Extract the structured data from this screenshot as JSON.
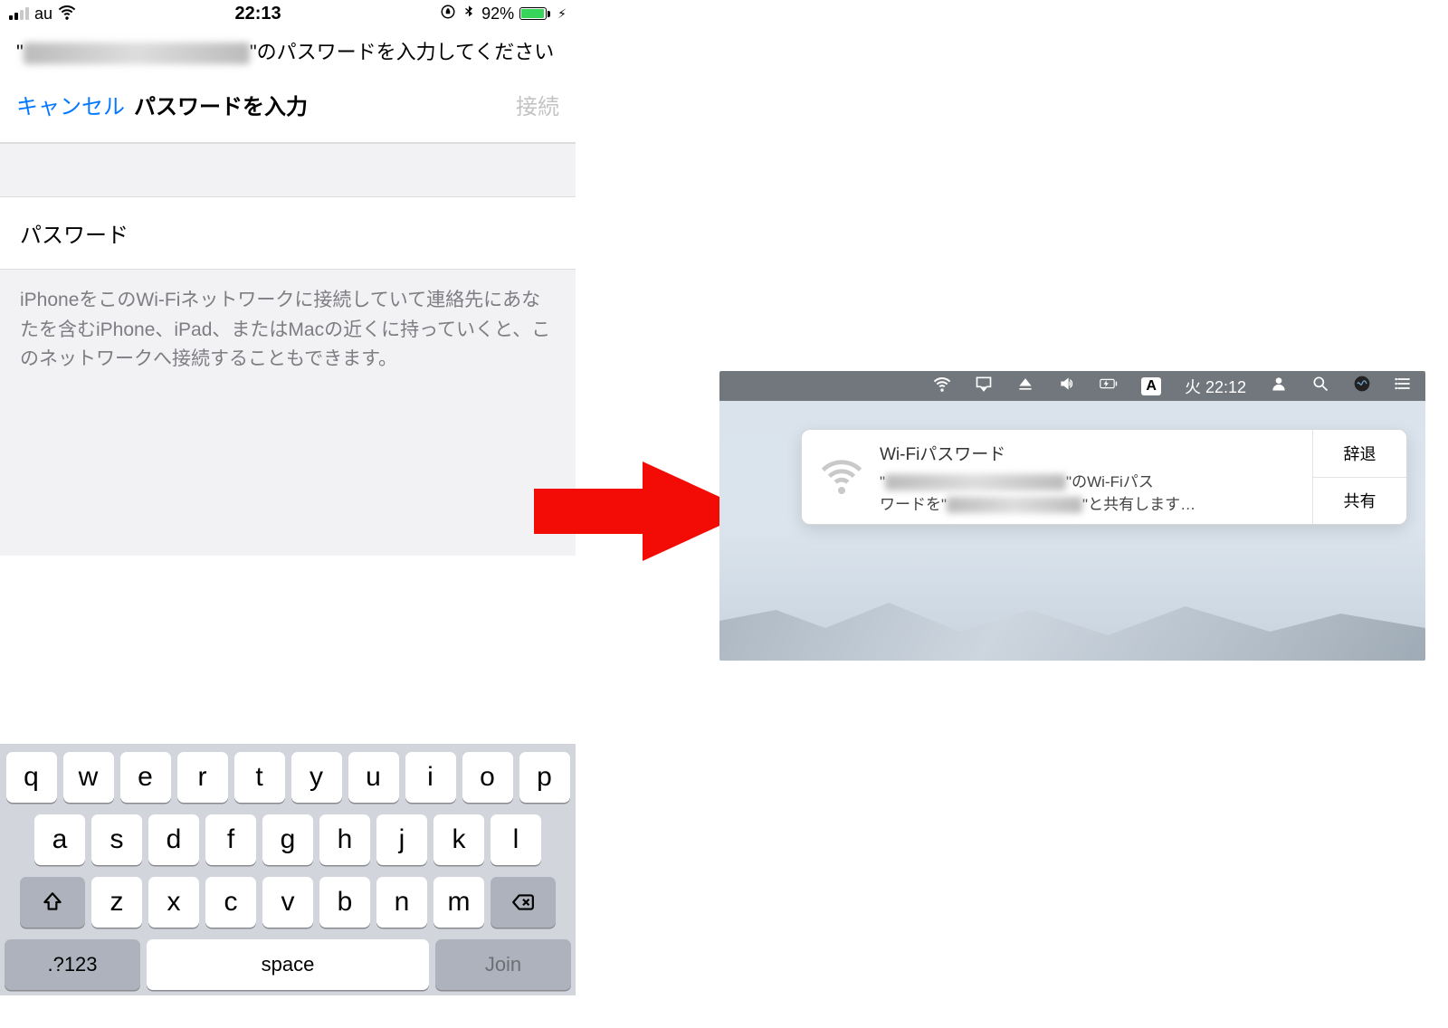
{
  "phone": {
    "status": {
      "carrier": "au",
      "time": "22:13",
      "battery": "92%"
    },
    "prompt_suffix": "\"のパスワードを入力してください",
    "nav": {
      "cancel": "キャンセル",
      "title": "パスワードを入力",
      "join": "接続"
    },
    "password_label": "パスワード",
    "info_text": "iPhoneをこのWi-Fiネットワークに接続していて連絡先にあなたを含むiPhone、iPad、またはMacの近くに持っていくと、このネットワークへ接続することもできます。",
    "keyboard": {
      "row1": [
        "q",
        "w",
        "e",
        "r",
        "t",
        "y",
        "u",
        "i",
        "o",
        "p"
      ],
      "row2": [
        "a",
        "s",
        "d",
        "f",
        "g",
        "h",
        "j",
        "k",
        "l"
      ],
      "row3": [
        "z",
        "x",
        "c",
        "v",
        "b",
        "n",
        "m"
      ],
      "numkey": ".?123",
      "space": "space",
      "go": "Join"
    }
  },
  "mac": {
    "menubar": {
      "input_badge": "A",
      "day": "火",
      "time": "22:12"
    },
    "notif": {
      "title": "Wi-Fiパスワード",
      "line1_prefix": "\"",
      "line1_suffix": "\"のWi-Fiパス",
      "line2_prefix": "ワードを\"",
      "line2_suffix": "\"と共有します…",
      "decline": "辞退",
      "share": "共有"
    }
  }
}
